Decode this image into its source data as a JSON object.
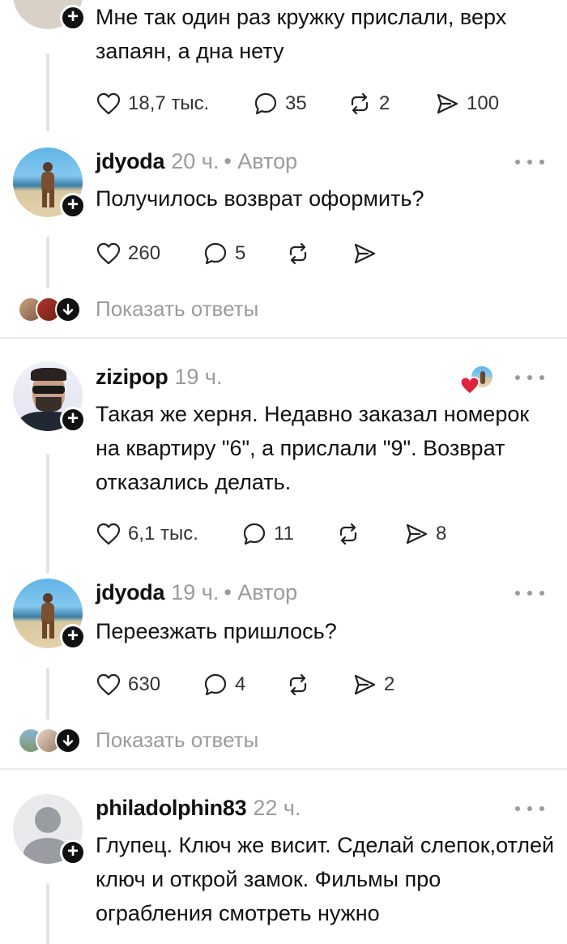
{
  "comments": [
    {
      "text": "Мне так один раз кружку прислали, верх запаян, а дна нету",
      "actions": {
        "likes": "18,7 тыс.",
        "replies": "35",
        "reposts": "2",
        "shares": "100"
      }
    },
    {
      "username": "jdyoda",
      "time": "20 ч.",
      "author_tag": "• Автор",
      "text": "Получилось возврат оформить?",
      "actions": {
        "likes": "260",
        "replies": "5",
        "reposts": "",
        "shares": ""
      }
    },
    {
      "username": "zizipop",
      "time": "19 ч.",
      "text": "Такая же херня. Недавно заказал номерок на квартиру \"6\", а прислали \"9\". Возврат отказались делать.",
      "actions": {
        "likes": "6,1 тыс.",
        "replies": "11",
        "reposts": "",
        "shares": "8"
      }
    },
    {
      "username": "jdyoda",
      "time": "19 ч.",
      "author_tag": "• Автор",
      "text": "Переезжать пришлось?",
      "actions": {
        "likes": "630",
        "replies": "4",
        "reposts": "",
        "shares": "2"
      }
    },
    {
      "username": "philadolphin83",
      "time": "22 ч.",
      "text": "Глупец. Ключ же висит. Сделай слепок,отлей ключ и открой замок. Фильмы про ограбления смотреть нужно"
    }
  ],
  "show_replies_label": "Показать ответы",
  "icons": {
    "like": "heart-icon",
    "reply": "speech-bubble-icon",
    "repost": "repost-icon",
    "share": "send-icon",
    "more": "more-dots-icon",
    "follow": "plus-icon",
    "expand": "arrow-down-icon"
  },
  "colors": {
    "text": "#111111",
    "muted": "#9b9b9b",
    "heart": "#e0243c"
  }
}
